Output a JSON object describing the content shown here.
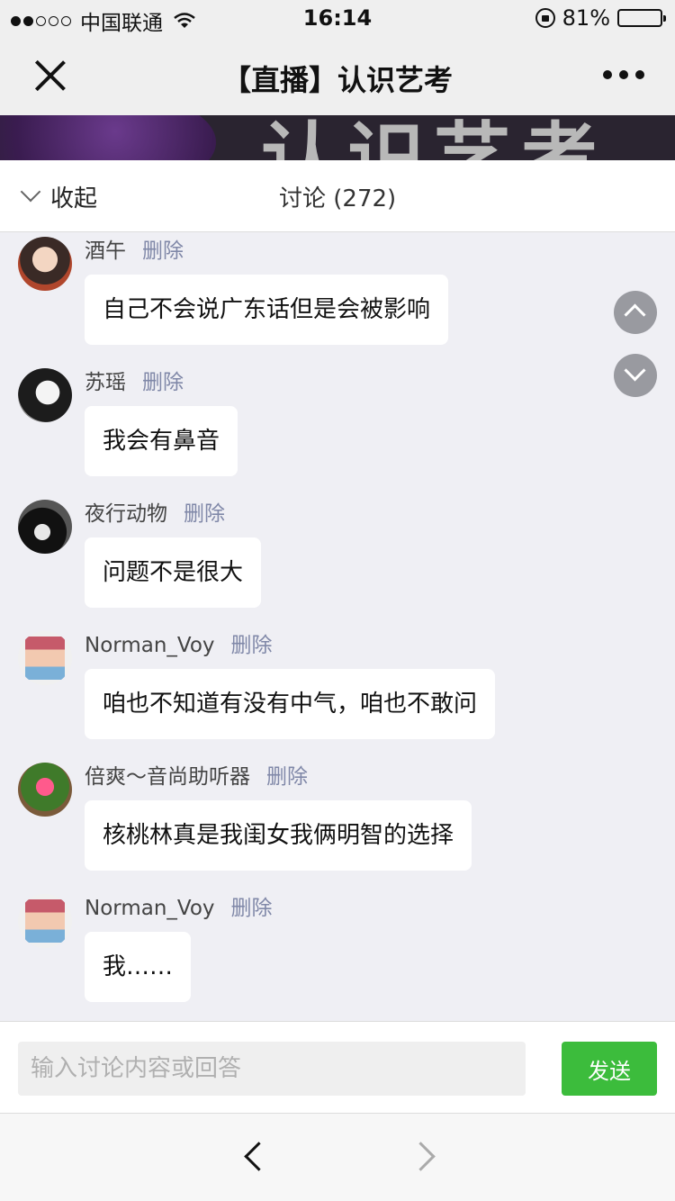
{
  "status": {
    "signal": "●●○○○",
    "carrier": "中国联通",
    "time": "16:14",
    "battery": "81%",
    "battery_level": 0.81
  },
  "nav": {
    "title": "【直播】认识艺考"
  },
  "banner": {
    "text": "认识艺考"
  },
  "discussion": {
    "collapse_label": "收起",
    "title": "讨论 (272)"
  },
  "messages": [
    {
      "user": "酒午",
      "delete": "删除",
      "text": "自己不会说广东话但是会被影响"
    },
    {
      "user": "苏瑶",
      "delete": "删除",
      "text": "我会有鼻音"
    },
    {
      "user": "夜行动物",
      "delete": "删除",
      "text": "问题不是很大"
    },
    {
      "user": "Norman_Voy",
      "delete": "删除",
      "text": "咱也不知道有没有中气，咱也不敢问"
    },
    {
      "user": "倍爽～音尚助听器",
      "delete": "删除",
      "text": "核桃林真是我闺女我俩明智的选择"
    },
    {
      "user": "Norman_Voy",
      "delete": "删除",
      "text": "我……"
    }
  ],
  "input": {
    "placeholder": "输入讨论内容或回答",
    "send_label": "发送"
  },
  "colors": {
    "send": "#3cbc3c",
    "delete_link": "#8088a8",
    "page_bg": "#efeff4"
  }
}
